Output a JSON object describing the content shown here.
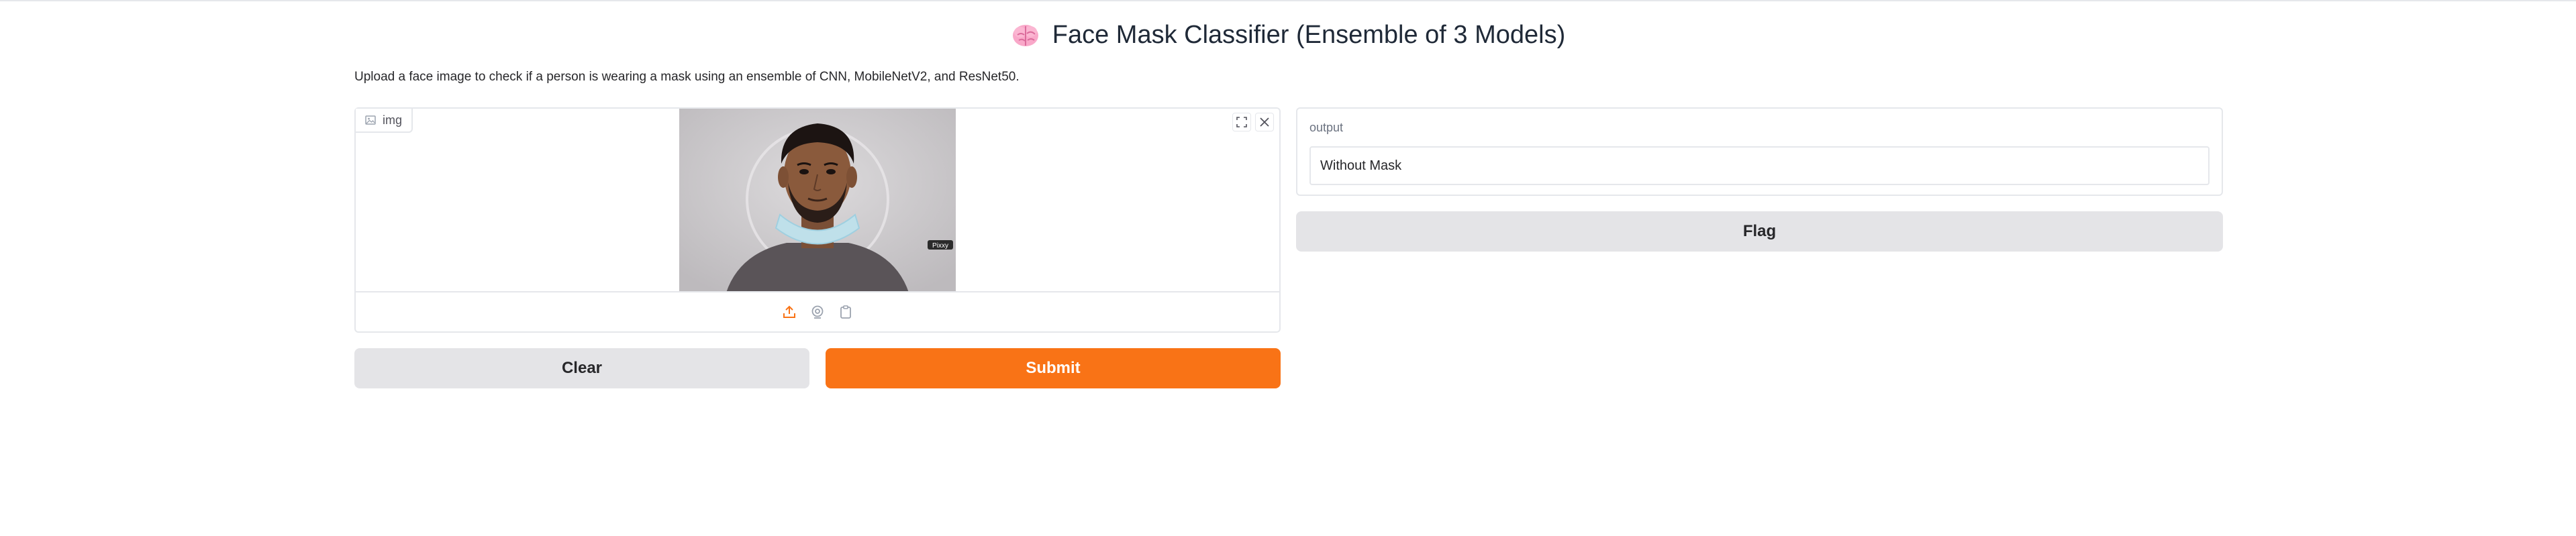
{
  "app": {
    "title": "Face Mask Classifier (Ensemble of 3 Models)",
    "title_icon": "brain-icon",
    "description": "Upload a face image to check if a person is wearing a mask using an ensemble of CNN, MobileNetV2, and ResNet50."
  },
  "input": {
    "label": "img",
    "label_icon": "image-icon",
    "watermark": "Pixxy",
    "tools": [
      "fullscreen-icon",
      "close-icon"
    ],
    "sources": [
      "upload-icon",
      "webcam-icon",
      "clipboard-icon"
    ]
  },
  "actions": {
    "clear_label": "Clear",
    "submit_label": "Submit",
    "flag_label": "Flag"
  },
  "output": {
    "label": "output",
    "value": "Without Mask"
  },
  "colors": {
    "accent": "#f97316",
    "secondary_button": "#e4e4e7",
    "border": "#e5e7eb"
  }
}
